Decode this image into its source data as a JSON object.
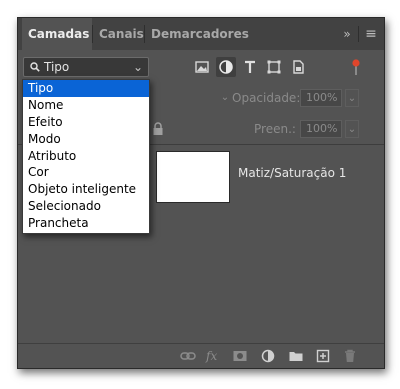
{
  "tabs": [
    {
      "label": "Camadas",
      "active": true
    },
    {
      "label": "Canais",
      "active": false
    },
    {
      "label": "Demarcadores",
      "active": false
    }
  ],
  "panel_controls": {
    "collapse": "»",
    "menu": "≡"
  },
  "filter": {
    "selected": "Tipo",
    "icons": [
      "image-filter-icon",
      "adjustment-filter-icon",
      "type-filter-icon",
      "shape-filter-icon",
      "smart-object-filter-icon"
    ],
    "switch_color": "#e0452b"
  },
  "opacity": {
    "label": "Opacidade:",
    "value": "100%"
  },
  "fill": {
    "label": "Preen.:",
    "value": "100%"
  },
  "layer": {
    "name": "Matiz/Saturação 1"
  },
  "dropdown": {
    "items": [
      "Tipo",
      "Nome",
      "Efeito",
      "Modo",
      "Atributo",
      "Cor",
      "Objeto inteligente",
      "Selecionado",
      "Prancheta"
    ],
    "selected_index": 0
  },
  "bottom_icons": [
    "link-icon",
    "fx-icon",
    "mask-icon",
    "adjustment-icon",
    "folder-icon",
    "new-layer-icon",
    "trash-icon"
  ],
  "colors": {
    "panel": "#535353",
    "tabbar": "#424242",
    "accent": "#0a64d6"
  }
}
